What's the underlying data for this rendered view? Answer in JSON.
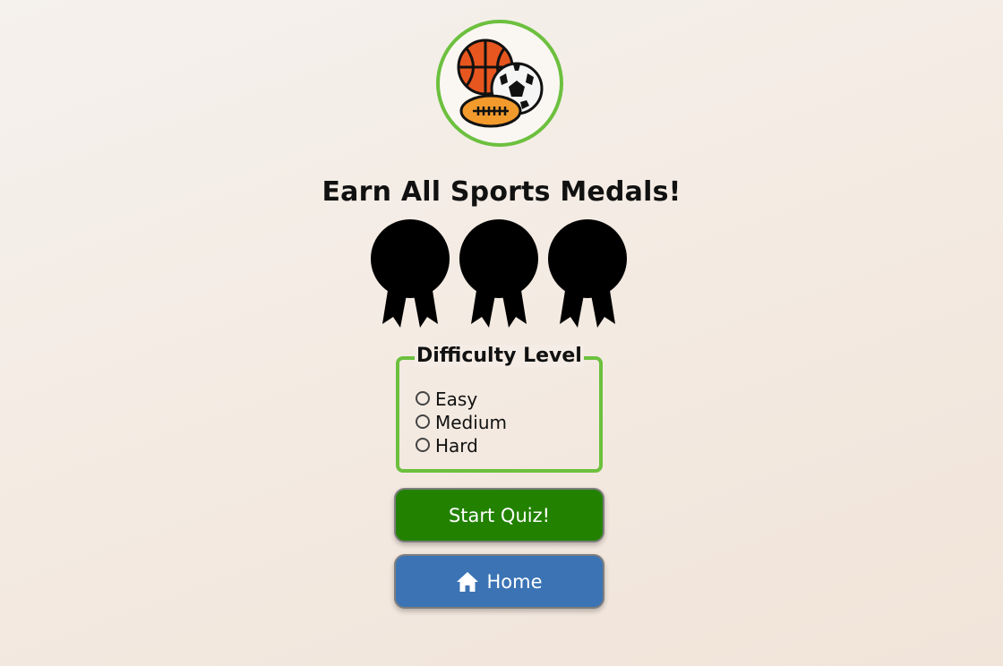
{
  "logo": {
    "icon": "sports-balls-icon",
    "accent": "#6cc03e"
  },
  "title": "Earn All Sports Medals!",
  "medals": [
    {
      "icon": "medal-icon",
      "earned": false
    },
    {
      "icon": "medal-icon",
      "earned": false
    },
    {
      "icon": "medal-icon",
      "earned": false
    }
  ],
  "difficulty": {
    "legend": "Difficulty Level",
    "options": [
      "Easy",
      "Medium",
      "Hard"
    ],
    "selected": null
  },
  "buttons": {
    "start_label": "Start Quiz!",
    "home_label": "Home",
    "home_icon": "home-icon"
  },
  "colors": {
    "start": "#228200",
    "home": "#3b73b4",
    "border": "#6cc03e"
  }
}
